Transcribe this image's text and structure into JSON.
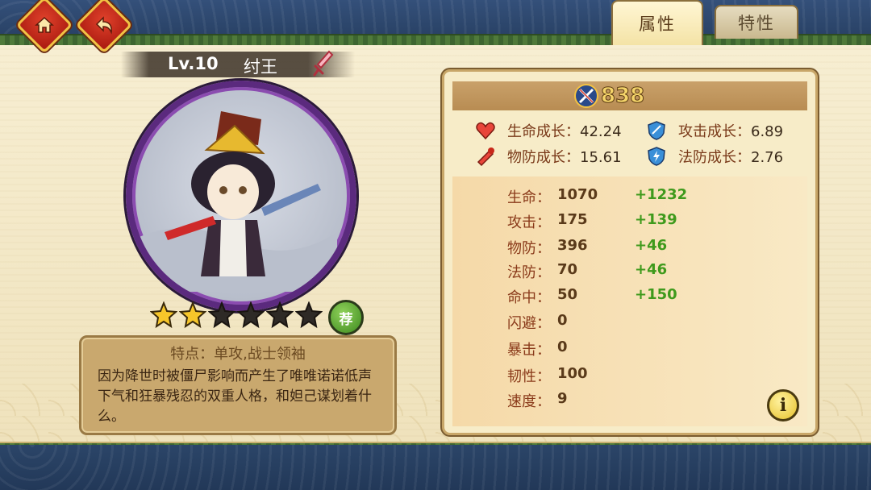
{
  "nav": {
    "home_icon": "home-icon",
    "back_icon": "back-arrow-icon"
  },
  "tabs": {
    "attributes": "属性",
    "traits": "特性"
  },
  "hero": {
    "level": "Lv.10",
    "name": "纣王",
    "stars_filled": 2,
    "stars_total": 6,
    "recommend_badge": "荐"
  },
  "description": {
    "title": "特点：单攻,战士领袖",
    "text": "因为降世时被僵尸影响而产生了唯唯诺诺低声下气和狂暴残忍的双重人格，和妲己谋划着什么。"
  },
  "power": {
    "value": "838",
    "icon": "swords-crossed-icon"
  },
  "growth": {
    "hp": {
      "label": "生命成长：",
      "value": "42.24"
    },
    "attack": {
      "label": "攻击成长：",
      "value": "6.89"
    },
    "pdef": {
      "label": "物防成长：",
      "value": "15.61"
    },
    "mdef": {
      "label": "法防成长：",
      "value": "2.76"
    }
  },
  "stats": [
    {
      "label": "生命：",
      "value": "1070",
      "bonus": "+1232"
    },
    {
      "label": "攻击：",
      "value": "175",
      "bonus": "+139"
    },
    {
      "label": "物防：",
      "value": "396",
      "bonus": "+46"
    },
    {
      "label": "法防：",
      "value": "70",
      "bonus": "+46"
    },
    {
      "label": "命中：",
      "value": "50",
      "bonus": "+150"
    },
    {
      "label": "闪避：",
      "value": "0",
      "bonus": ""
    },
    {
      "label": "暴击：",
      "value": "0",
      "bonus": ""
    },
    {
      "label": "韧性：",
      "value": "100",
      "bonus": ""
    },
    {
      "label": "速度：",
      "value": "9",
      "bonus": ""
    }
  ],
  "info_button": "i",
  "colors": {
    "accent_red": "#c8281a",
    "gold": "#f3c243",
    "bonus_green": "#3f9a1c",
    "purple_frame": "#5b2a7e"
  }
}
